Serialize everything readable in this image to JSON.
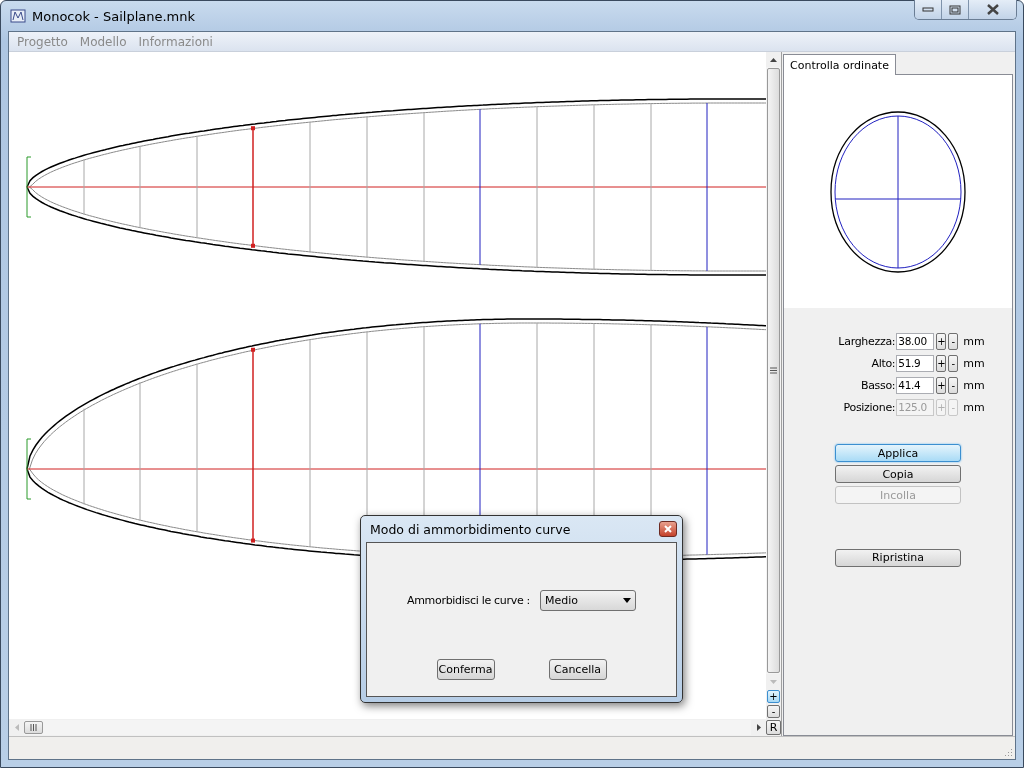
{
  "window": {
    "title": "Monocok - Sailplane.mnk"
  },
  "menu": [
    {
      "label": "Progetto"
    },
    {
      "label": "Modello"
    },
    {
      "label": "Informazioni"
    }
  ],
  "zoom_buttons": [
    {
      "label": "+",
      "focused": true
    },
    {
      "label": "-",
      "focused": false
    }
  ],
  "reset_view_button": {
    "label": "R"
  },
  "panel": {
    "tabs": [
      {
        "label": "Controlla ordinate",
        "selected": true
      }
    ],
    "fields": [
      {
        "label": "Larghezza:",
        "value": "38.00",
        "plus": "+",
        "minus": "-",
        "unit": "mm",
        "disabled": false
      },
      {
        "label": "Alto:",
        "value": "51.9",
        "plus": "+",
        "minus": "-",
        "unit": "mm",
        "disabled": false
      },
      {
        "label": "Basso:",
        "value": "41.4",
        "plus": "+",
        "minus": "-",
        "unit": "mm",
        "disabled": false
      },
      {
        "label": "Posizione:",
        "value": "125.0",
        "plus": "+",
        "minus": "-",
        "unit": "mm",
        "disabled": true
      }
    ],
    "buttons": [
      {
        "label": "Applica",
        "focused": true,
        "disabled": false
      },
      {
        "label": "Copia",
        "focused": false,
        "disabled": false
      },
      {
        "label": "Incolla",
        "focused": false,
        "disabled": true
      }
    ],
    "reset_button": {
      "label": "Ripristina"
    }
  },
  "dialog": {
    "title": "Modo di ammorbidimento curve",
    "field_label": "Ammorbidisci le curve :",
    "select_value": "Medio",
    "buttons": [
      {
        "label": "Conferma"
      },
      {
        "label": "Cancella"
      }
    ]
  }
}
